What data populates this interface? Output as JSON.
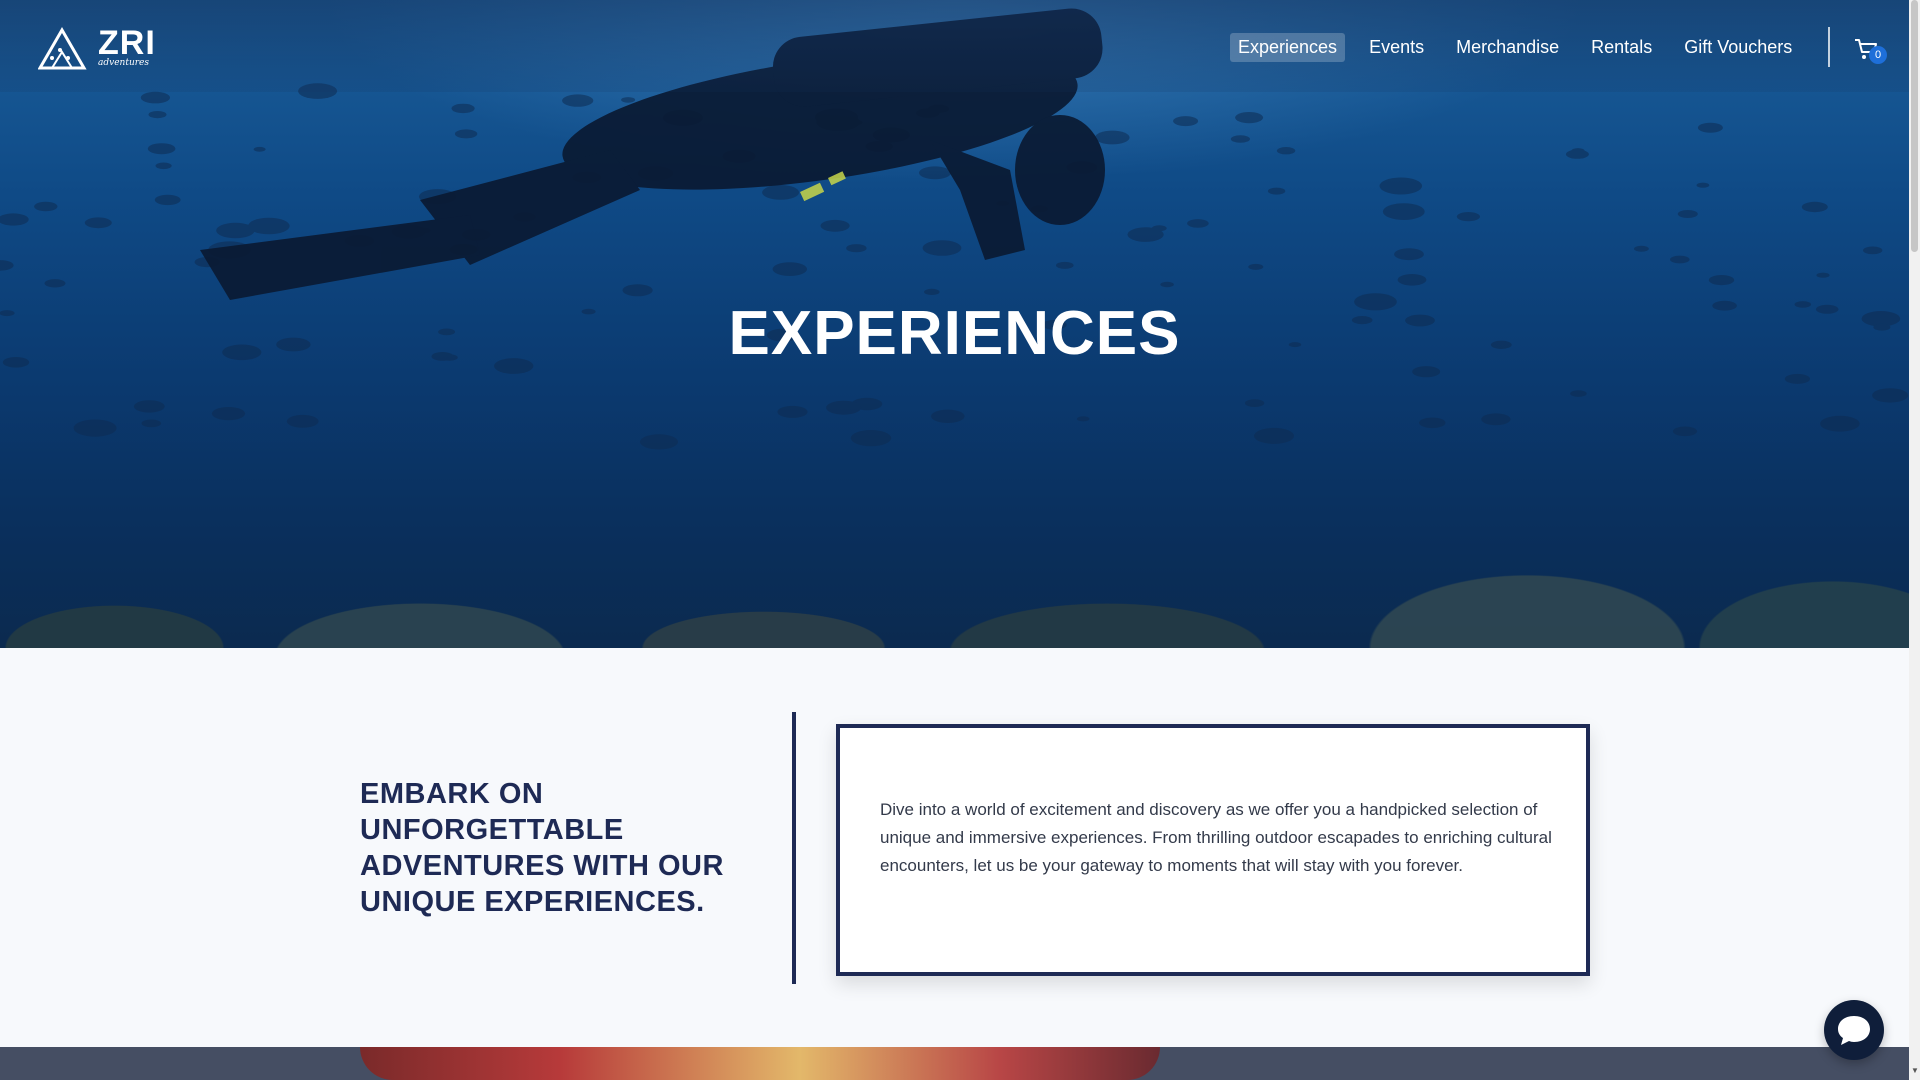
{
  "brand": {
    "name": "ZRI",
    "sub": "adventures"
  },
  "nav": {
    "items": [
      {
        "label": "Experiences",
        "active": true
      },
      {
        "label": "Events",
        "active": false
      },
      {
        "label": "Merchandise",
        "active": false
      },
      {
        "label": "Rentals",
        "active": false
      },
      {
        "label": "Gift Vouchers",
        "active": false
      }
    ],
    "cart_count": "0"
  },
  "hero": {
    "title": "EXPERIENCES"
  },
  "intro": {
    "heading": "EMBARK ON UNFORGETTABLE ADVENTURES WITH OUR UNIQUE EXPERIENCES.",
    "body": "Dive into a world of excitement and discovery as we offer you a handpicked selection of unique and immersive experiences. From thrilling outdoor escapades to enriching cultural encounters, let us be your gateway to moments that will stay with you forever."
  },
  "colors": {
    "navy": "#1e2a55",
    "accent_blue": "#1e6fd9",
    "chat_button": "#0f1e3a"
  },
  "icons": {
    "cart": "cart-icon",
    "chat": "chat-icon",
    "logo": "mountain-logo-icon"
  }
}
